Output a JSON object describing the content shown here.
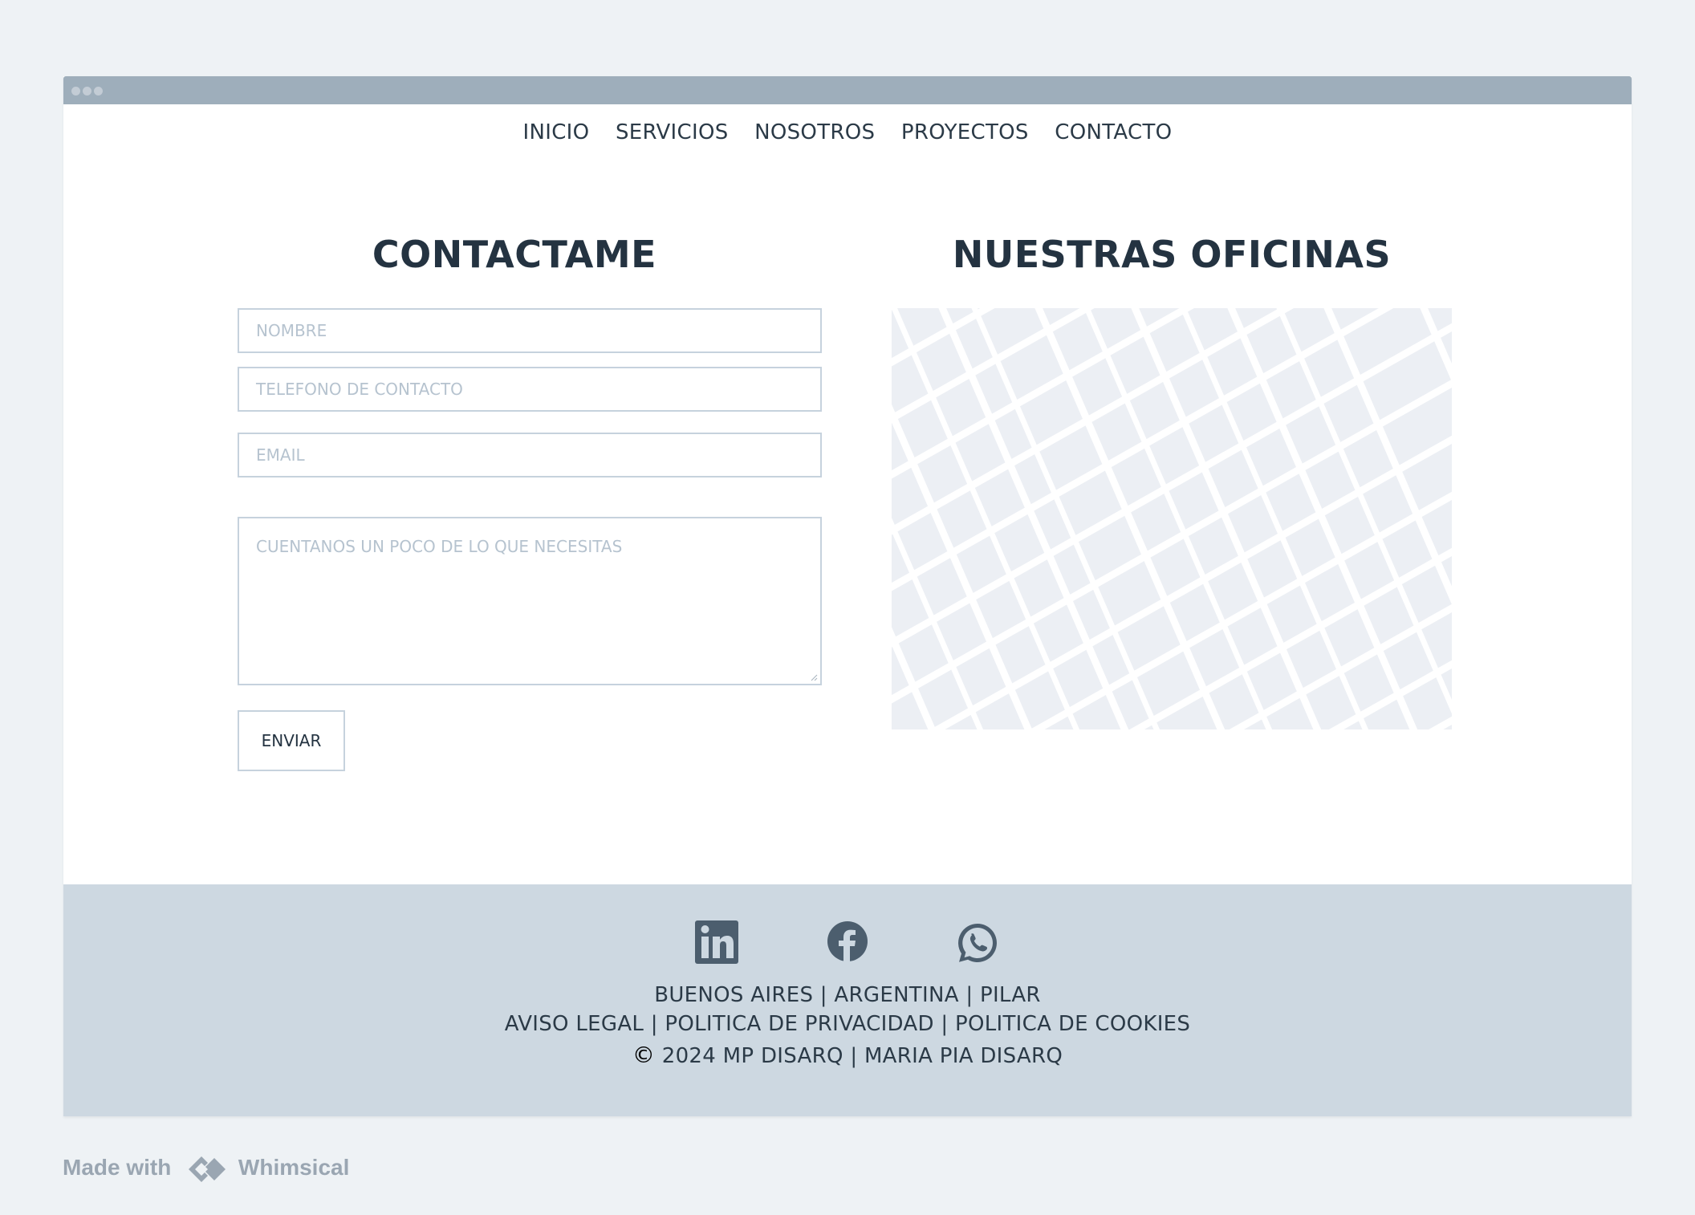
{
  "nav": {
    "items": [
      "INICIO",
      "SERVICIOS",
      "NOSOTROS",
      "PROYECTOS",
      "CONTACTO"
    ]
  },
  "contact": {
    "title": "CONTACTAME",
    "name_placeholder": "NOMBRE",
    "phone_placeholder": "TELEFONO DE CONTACTO",
    "email_placeholder": "EMAIL",
    "message_placeholder": "CUENTANOS UN POCO DE LO QUE NECESITAS",
    "submit_label": "ENVIAR"
  },
  "offices": {
    "title": "NUESTRAS OFICINAS"
  },
  "footer": {
    "social": [
      "linkedin-icon",
      "facebook-icon",
      "whatsapp-icon"
    ],
    "location": "BUENOS AIRES | ARGENTINA | PILAR",
    "legal": "AVISO LEGAL | POLITICA DE PRIVACIDAD | POLITICA DE COOKIES",
    "copyright_symbol": "©",
    "copyright": "2024 MP DISARQ | MARIA PIA DISARQ"
  },
  "branding": {
    "made_with": "Made with",
    "name": "Whimsical"
  },
  "colors": {
    "page_bg": "#eef2f5",
    "titlebar": "#9eaebb",
    "footer_bg": "#cdd8e1",
    "text": "#2b3a47",
    "placeholder": "#b6c3cf",
    "icon": "#4c5e6e",
    "map_block": "#eceff4"
  }
}
